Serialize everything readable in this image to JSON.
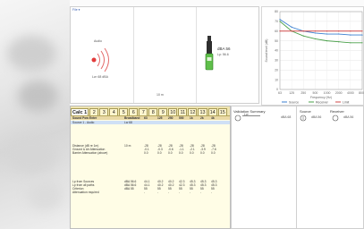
{
  "top_window": {
    "menu": "File ▾",
    "source_label": "Audio",
    "source_level": "Lw: 68 dBA",
    "meter_reading": "dBA 56",
    "meter_sublabel": "Lp: 56.6",
    "distance_label": "10 m"
  },
  "chart_data": {
    "type": "line",
    "title": "",
    "xlabel": "Frequency (Hz)",
    "ylabel": "Sound level (dB)",
    "x": [
      63,
      125,
      250,
      500,
      1000,
      2000,
      4000,
      8000
    ],
    "x_tick_labels": [
      "63",
      "125",
      "250",
      "500",
      "1000",
      "2000",
      "4000",
      "8000"
    ],
    "ylim": [
      0,
      80
    ],
    "y_ticks": [
      0,
      10,
      20,
      30,
      40,
      50,
      60,
      70,
      80
    ],
    "series": [
      {
        "name": "Source",
        "values": [
          72,
          64,
          60,
          58,
          57,
          57,
          56,
          56
        ],
        "color": "#3a7fd0"
      },
      {
        "name": "Receiver",
        "values": [
          70,
          60,
          55,
          52,
          50,
          49,
          48,
          48
        ],
        "color": "#4aa04a"
      },
      {
        "name": "Limit",
        "values": [
          60,
          60,
          60,
          60,
          60,
          60,
          60,
          60
        ],
        "color": "#d04a4a"
      }
    ],
    "grid": true,
    "legend": "bottom"
  },
  "sheet": {
    "tabs": [
      "Calc 1",
      "2",
      "3",
      "4",
      "5",
      "6",
      "7",
      "8",
      "9",
      "10",
      "11",
      "12",
      "13",
      "14",
      "15"
    ],
    "active_tab": 0,
    "header": {
      "label": "Sound Pow Enter",
      "values": [
        "Broadband",
        "63",
        "125",
        "250",
        "500",
        "1k",
        "2k",
        "4k"
      ]
    },
    "rows": [
      {
        "label": "Source 1 - Audio",
        "values": [
          "Lw 68",
          "",
          "",
          "",
          "",
          "",
          "",
          ""
        ]
      },
      {
        "label": "",
        "values": [
          "",
          "",
          "",
          "",
          "",
          "",
          "",
          ""
        ]
      },
      {
        "label": "Distance (dB re 1m)",
        "values": [
          "10 m",
          "-28",
          "-28",
          "-28",
          "-28",
          "-28",
          "-28",
          "-28"
        ]
      },
      {
        "label": "Ground & Air Attenuation",
        "values": [
          "",
          "-0.1",
          "-0.3",
          "-0.6",
          "-1.1",
          "-2.1",
          "-3.9",
          "-7.6"
        ]
      },
      {
        "label": "Barrier Attenuation (above)",
        "values": [
          "",
          "0.0",
          "0.0",
          "0.0",
          "0.0",
          "0.0",
          "0.0",
          "0.0"
        ]
      },
      {
        "label": "Lp from Sources",
        "values": [
          "dBA 56.6",
          "44.1",
          "40.2",
          "40.2",
          "42.3",
          "45.3",
          "45.3",
          "45.3"
        ]
      },
      {
        "label": "Lp from all paths",
        "values": [
          "dBA 56.6",
          "44.1",
          "40.2",
          "40.2",
          "42.3",
          "45.3",
          "45.3",
          "45.3"
        ]
      },
      {
        "label": "Criterion",
        "values": [
          "dBA 55",
          "55",
          "55",
          "55",
          "55",
          "55",
          "55",
          "55"
        ]
      },
      {
        "label": "Attenuation required",
        "values": [
          "",
          "-",
          "-",
          "-",
          "-",
          "-",
          "-",
          "-"
        ]
      },
      {
        "label": "Information",
        "values": [
          "",
          "",
          "",
          "",
          "",
          "",
          "",
          ""
        ]
      }
    ]
  },
  "validation": {
    "title": "Validation Summary",
    "item": "Lw",
    "item_value": "dBA 68"
  },
  "receiver_panel": {
    "source_title": "Source",
    "receiver_title": "Receiver",
    "source_value": "dBA 56",
    "receiver_value": "dBA 56"
  }
}
